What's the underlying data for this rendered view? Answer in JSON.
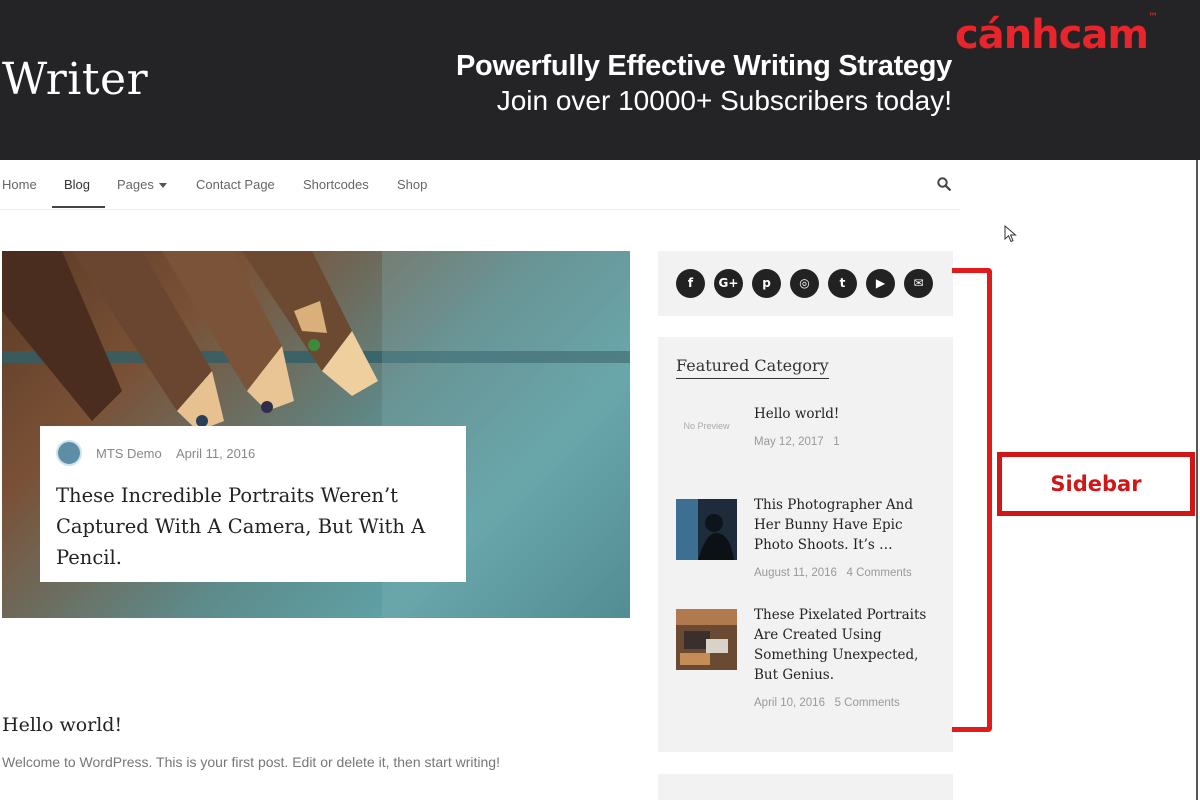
{
  "header": {
    "site_title": "Writer",
    "promo_line1": "Powerfully Effective Writing Strategy",
    "promo_line2": "Join over 10000+ Subscribers today!",
    "watermark": "cánhcam"
  },
  "nav": {
    "items": [
      {
        "label": "Home"
      },
      {
        "label": "Blog"
      },
      {
        "label": "Pages"
      },
      {
        "label": "Contact Page"
      },
      {
        "label": "Shortcodes"
      },
      {
        "label": "Shop"
      }
    ],
    "active": "Blog"
  },
  "hero": {
    "author": "MTS Demo",
    "date": "April 11, 2016",
    "title": "These Incredible Portraits Weren’t Captured With A Camera, But With A Pencil."
  },
  "post": {
    "title": "Hello world!",
    "excerpt": "Welcome to WordPress. This is your first post. Edit or delete it, then start writing!"
  },
  "sidebar": {
    "social_icons": [
      "facebook-icon",
      "google-plus-icon",
      "pinterest-icon",
      "instagram-icon",
      "twitter-icon",
      "youtube-icon",
      "email-icon"
    ],
    "social_glyphs": [
      "f",
      "G+",
      "p",
      "◎",
      "t",
      "▶",
      "✉"
    ],
    "featured_title": "Featured Category",
    "no_preview": "No Preview",
    "featured": [
      {
        "title": "Hello world!",
        "date": "May 12, 2017",
        "comments": "1"
      },
      {
        "title": "This Photographer And Her Bunny Have Epic Photo Shoots. It’s …",
        "date": "August 11, 2016",
        "comments": "4 Comments"
      },
      {
        "title": "These Pixelated Portraits Are Created Using Something Unexpected, But Genius.",
        "date": "April 10, 2016",
        "comments": "5 Comments"
      }
    ]
  },
  "annotation": {
    "label": "Sidebar",
    "color": "#d01616"
  }
}
